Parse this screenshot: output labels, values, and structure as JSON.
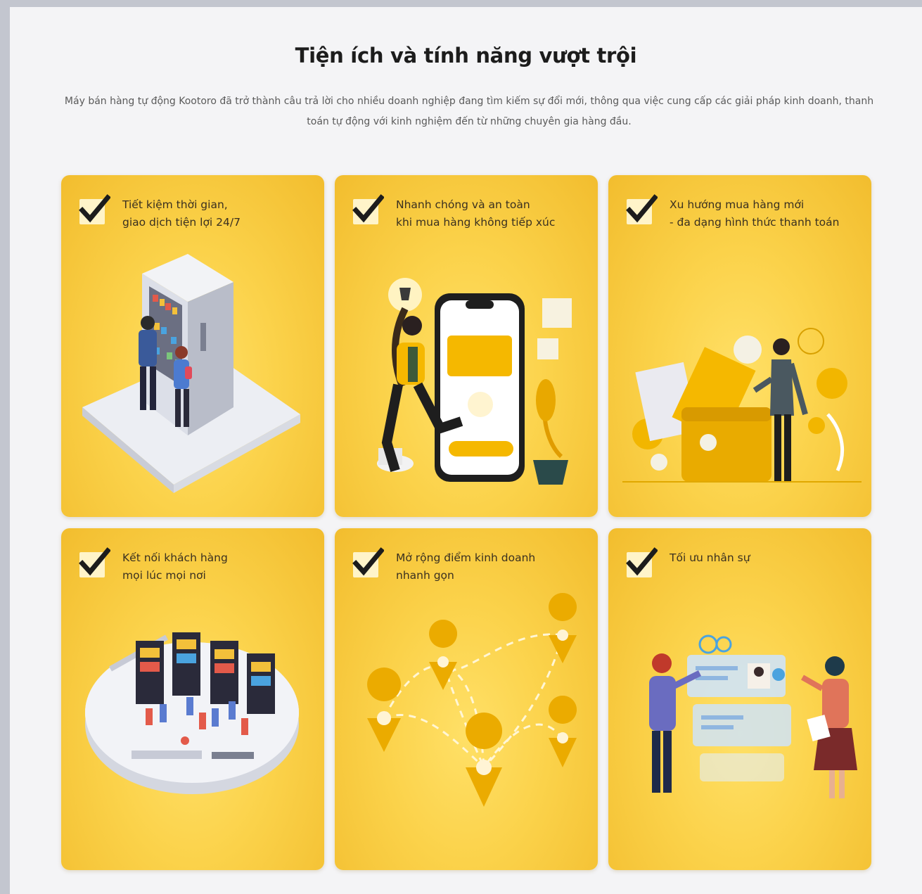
{
  "section": {
    "title": "Tiện ích và tính năng vượt trội",
    "description": "Máy bán hàng tự động Kootoro đã trở thành câu trả lời cho nhiều doanh nghiệp đang tìm kiếm sự đổi mới, thông qua việc cung cấp các giải pháp kinh doanh, thanh toán tự động với kinh nghiệm đến từ những chuyên gia hàng đầu."
  },
  "features": [
    {
      "line1": "Tiết kiệm thời gian,",
      "line2": "giao dịch tiện lợi 24/7",
      "illustration": "vending-machine-customers"
    },
    {
      "line1": "Nhanh chóng và an toàn",
      "line2": "khi mua hàng không tiếp xúc",
      "illustration": "mobile-payment"
    },
    {
      "line1": "Xu hướng mua hàng mới",
      "line2": "- đa dạng hình thức thanh toán",
      "illustration": "wallet-payment"
    },
    {
      "line1": "Kết nối khách hàng",
      "line2": "mọi lúc mọi nơi",
      "illustration": "connected-vending-hub"
    },
    {
      "line1": "Mở rộng điểm kinh doanh",
      "line2": "nhanh gọn",
      "illustration": "location-pins-network"
    },
    {
      "line1": "Tối ưu nhân sự",
      "line2": "",
      "illustration": "staff-profiles"
    }
  ],
  "colors": {
    "card_yellow": "#f9cc3e",
    "accent": "#f5b800",
    "check": "#1c1c1c"
  }
}
